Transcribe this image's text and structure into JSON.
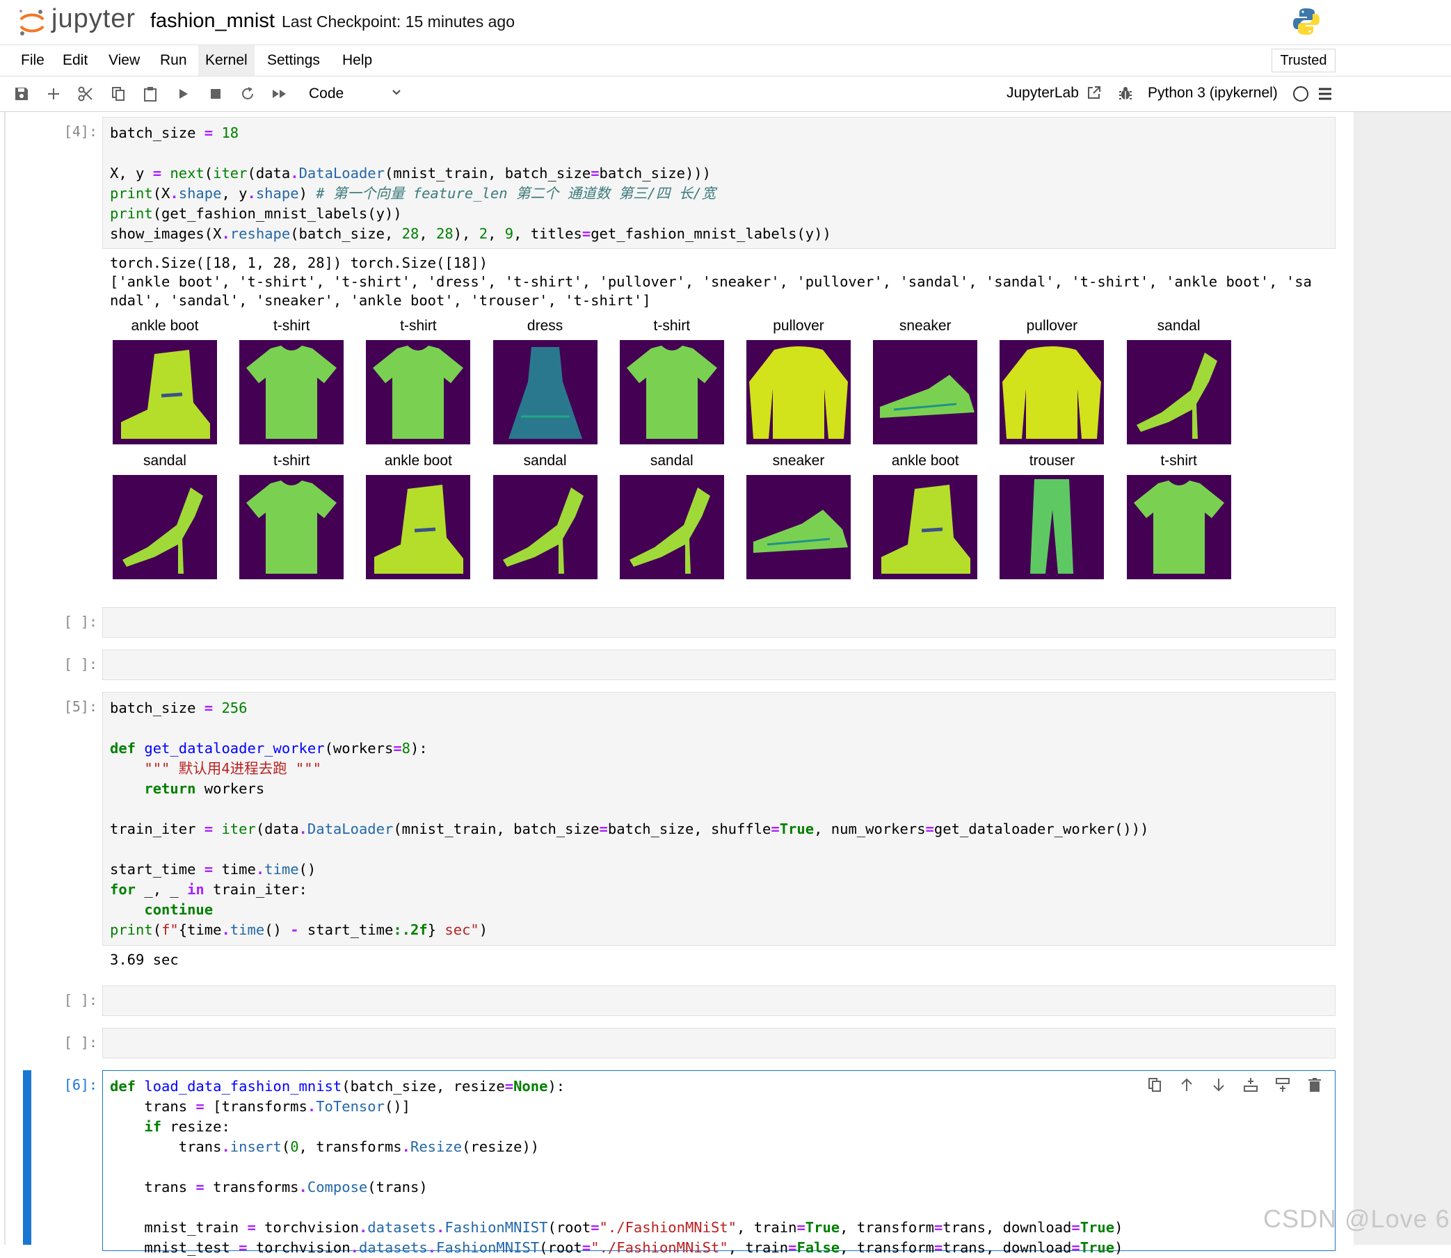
{
  "app": {
    "logo_text": "jupyter",
    "notebook_name": "fashion_mnist",
    "checkpoint": "Last Checkpoint: 15 minutes ago"
  },
  "menu": {
    "items": [
      "File",
      "Edit",
      "View",
      "Run",
      "Kernel",
      "Settings",
      "Help"
    ],
    "active": "Kernel",
    "trusted": "Trusted"
  },
  "toolbar": {
    "cell_type": "Code",
    "jupyterlab_link": "JupyterLab",
    "kernel": "Python 3 (ipykernel)"
  },
  "cells": {
    "c1": {
      "prompt": "[4]:",
      "output_lines": [
        "torch.Size([18, 1, 28, 28]) torch.Size([18])",
        "['ankle boot', 't-shirt', 't-shirt', 'dress', 't-shirt', 'pullover', 'sneaker', 'pullover', 'sandal', 'sandal', 't-shirt', 'ankle boot', 'sa",
        "ndal', 'sandal', 'sneaker', 'ankle boot', 'trouser', 't-shirt']"
      ],
      "image_titles_row1": [
        "ankle boot",
        "t-shirt",
        "t-shirt",
        "dress",
        "t-shirt",
        "pullover",
        "sneaker",
        "pullover",
        "sandal"
      ],
      "image_titles_row2": [
        "sandal",
        "t-shirt",
        "ankle boot",
        "sandal",
        "sandal",
        "sneaker",
        "ankle boot",
        "trouser",
        "t-shirt"
      ]
    },
    "c2": {
      "prompt": "[ ]:"
    },
    "c3": {
      "prompt": "[ ]:"
    },
    "c4": {
      "prompt": "[5]:",
      "output": "3.69 sec"
    },
    "c5": {
      "prompt": "[ ]:"
    },
    "c6": {
      "prompt": "[ ]:"
    },
    "c7": {
      "prompt": "[6]:"
    }
  },
  "watermark": "CSDN @Love 6",
  "colors": {
    "accent": "#1976d2",
    "viridis_bg": "#440154",
    "viridis_fg": "#fde725"
  },
  "icons": [
    "save-icon",
    "add-cell-icon",
    "cut-icon",
    "copy-icon",
    "paste-icon",
    "run-icon",
    "stop-icon",
    "restart-icon",
    "run-all-icon",
    "external-link-icon",
    "bug-icon",
    "kernel-status-icon",
    "menu-icon",
    "python-logo-icon",
    "jupyter-logo-icon"
  ]
}
